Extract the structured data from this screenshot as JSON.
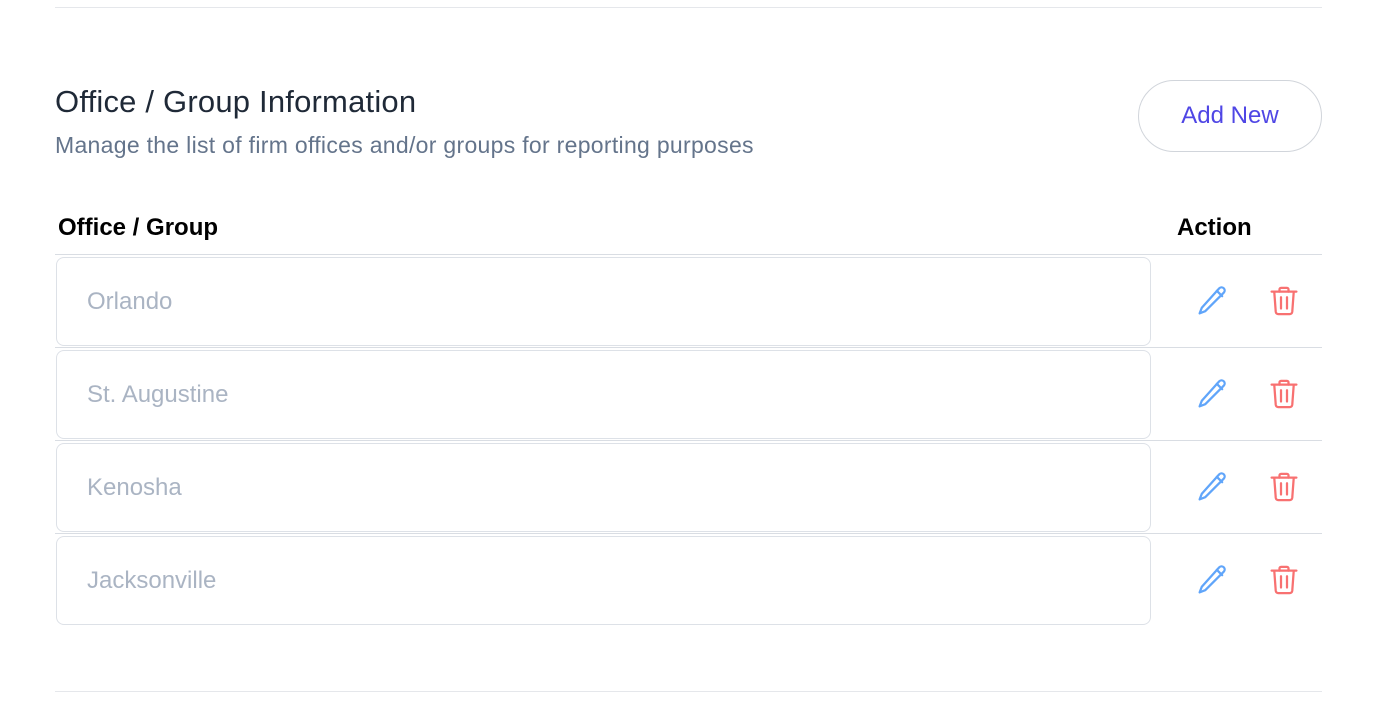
{
  "section": {
    "title": "Office / Group Information",
    "subtitle": "Manage the list of firm offices and/or groups for reporting purposes",
    "add_button_label": "Add New"
  },
  "table": {
    "columns": [
      "Office / Group",
      "Action"
    ],
    "rows": [
      {
        "placeholder": "Orlando"
      },
      {
        "placeholder": "St. Augustine"
      },
      {
        "placeholder": "Kenosha"
      },
      {
        "placeholder": "Jacksonville"
      }
    ],
    "row_icons": [
      "pencil-icon",
      "trash-icon"
    ]
  },
  "colors": {
    "accent": "#4f46e5",
    "edit_icon": "#60a5fa",
    "delete_icon": "#f87171",
    "placeholder_text": "#aab4c3"
  }
}
